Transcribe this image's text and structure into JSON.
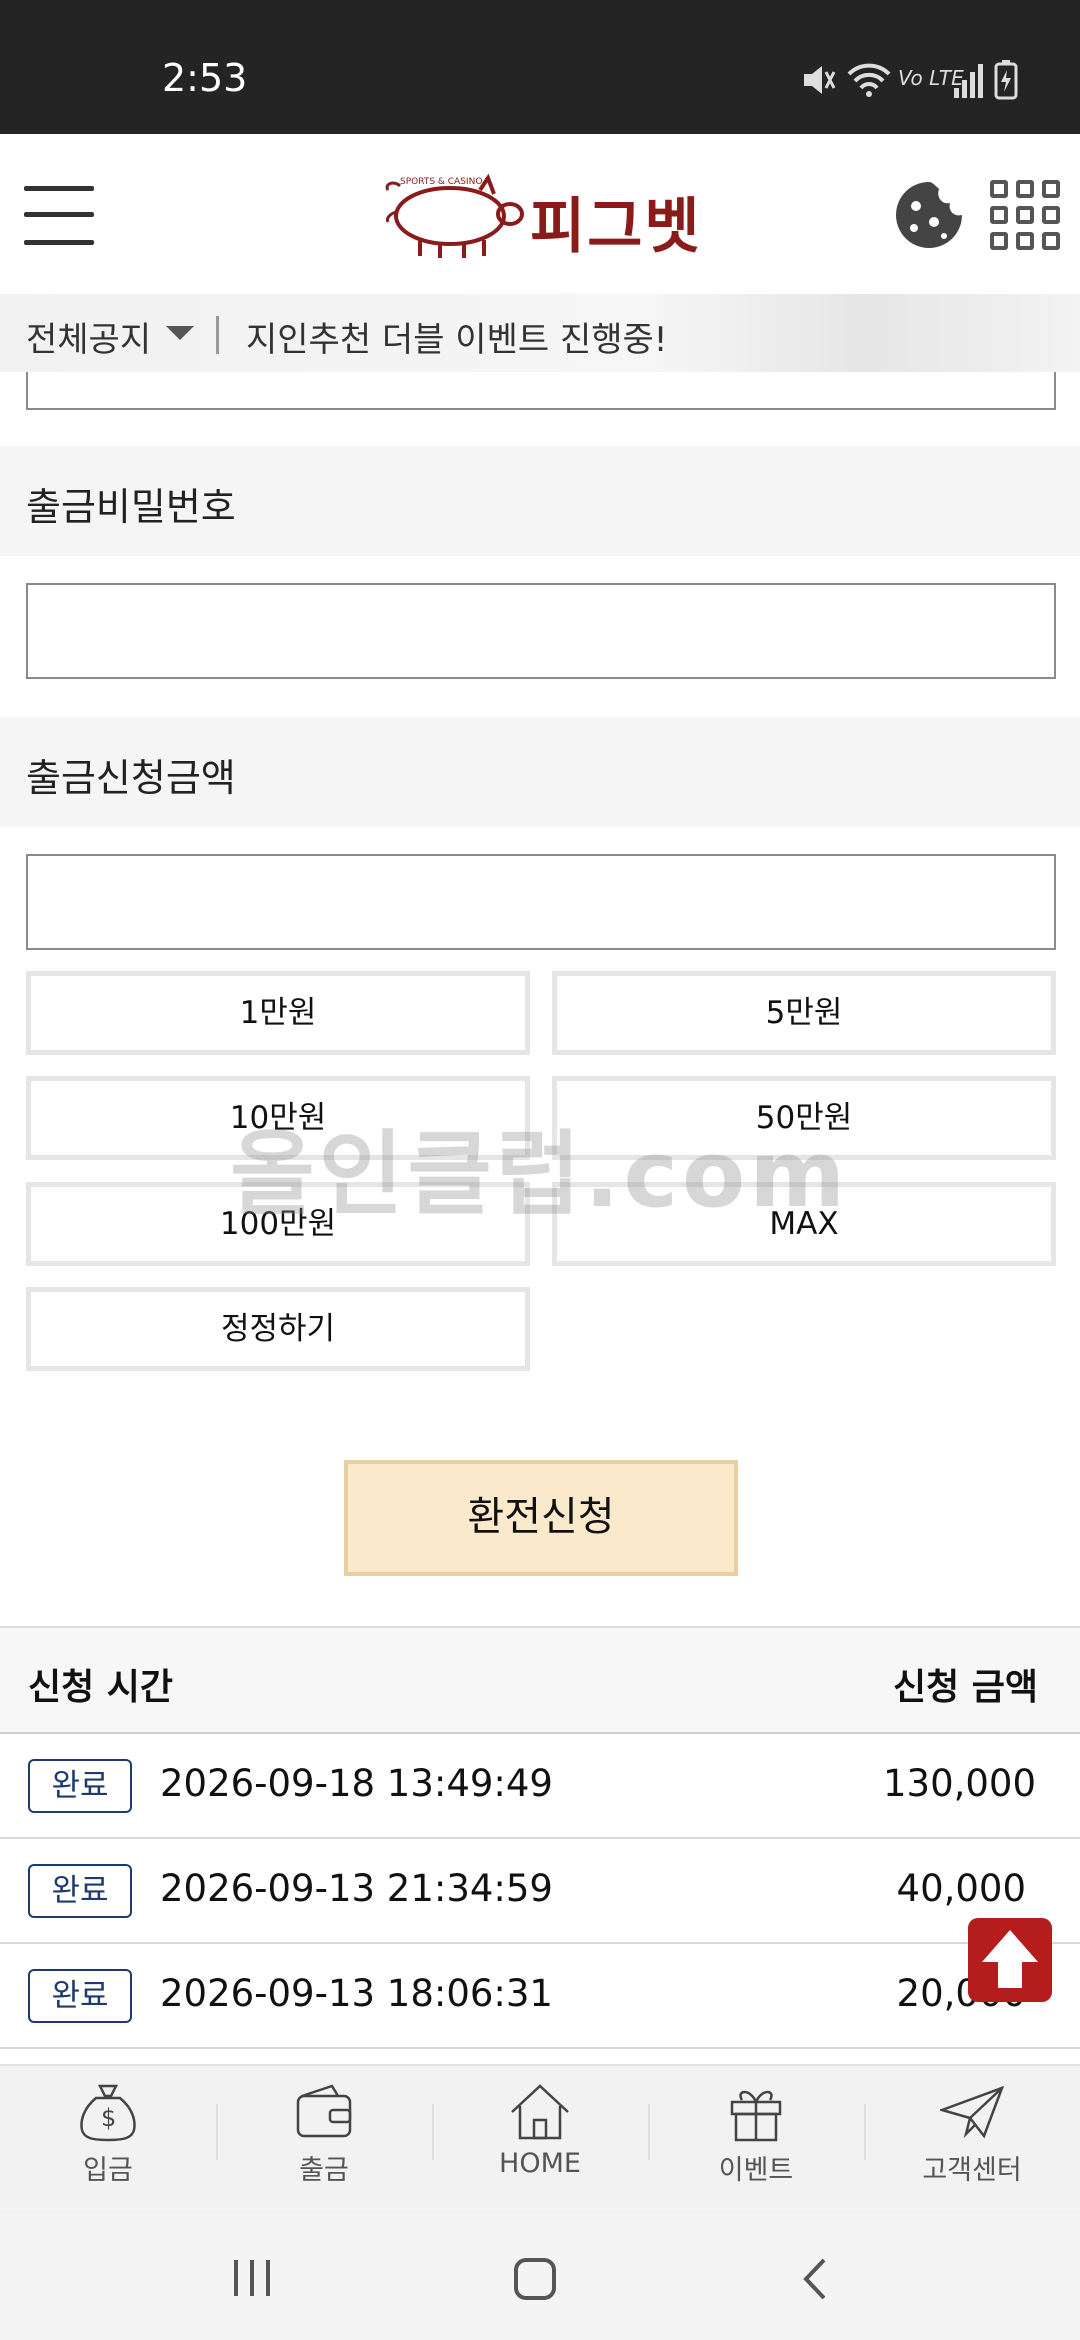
{
  "status_bar": {
    "time": "2:53",
    "network_label": "Vo LTE"
  },
  "header": {
    "logo_text": "피그벳",
    "logo_tagline": "SPORTS & CASINO"
  },
  "notice": {
    "label": "전체공지",
    "text": "지인추천 더블 이벤트 진행중!"
  },
  "withdraw_form": {
    "password_label": "출금비밀번호",
    "password_value": "",
    "amount_label": "출금신청금액",
    "amount_value": "",
    "quick_amounts": [
      "1만원",
      "5만원",
      "10만원",
      "50만원",
      "100만원",
      "MAX"
    ],
    "reset_label": "정정하기",
    "submit_label": "환전신청"
  },
  "history": {
    "col_time": "신청 시간",
    "col_amount": "신청 금액",
    "rows": [
      {
        "status": "완료",
        "time": "2026-09-18 13:49:49",
        "amount": "130,000"
      },
      {
        "status": "완료",
        "time": "2026-09-13 21:34:59",
        "amount": "40,000"
      },
      {
        "status": "완료",
        "time": "2026-09-13 18:06:31",
        "amount": "20,000"
      }
    ]
  },
  "watermark": "올인클럽.com",
  "bottom_nav": [
    {
      "label": "입금",
      "icon": "money-bag-icon"
    },
    {
      "label": "출금",
      "icon": "wallet-icon"
    },
    {
      "label": "HOME",
      "icon": "house-icon"
    },
    {
      "label": "이벤트",
      "icon": "gift-icon"
    },
    {
      "label": "고객센터",
      "icon": "paper-plane-icon"
    }
  ],
  "colors": {
    "brand": "#8b1a1a",
    "submit_bg": "#faeacb",
    "badge": "#1e3a6e",
    "scroll_top": "#b51c1c"
  }
}
